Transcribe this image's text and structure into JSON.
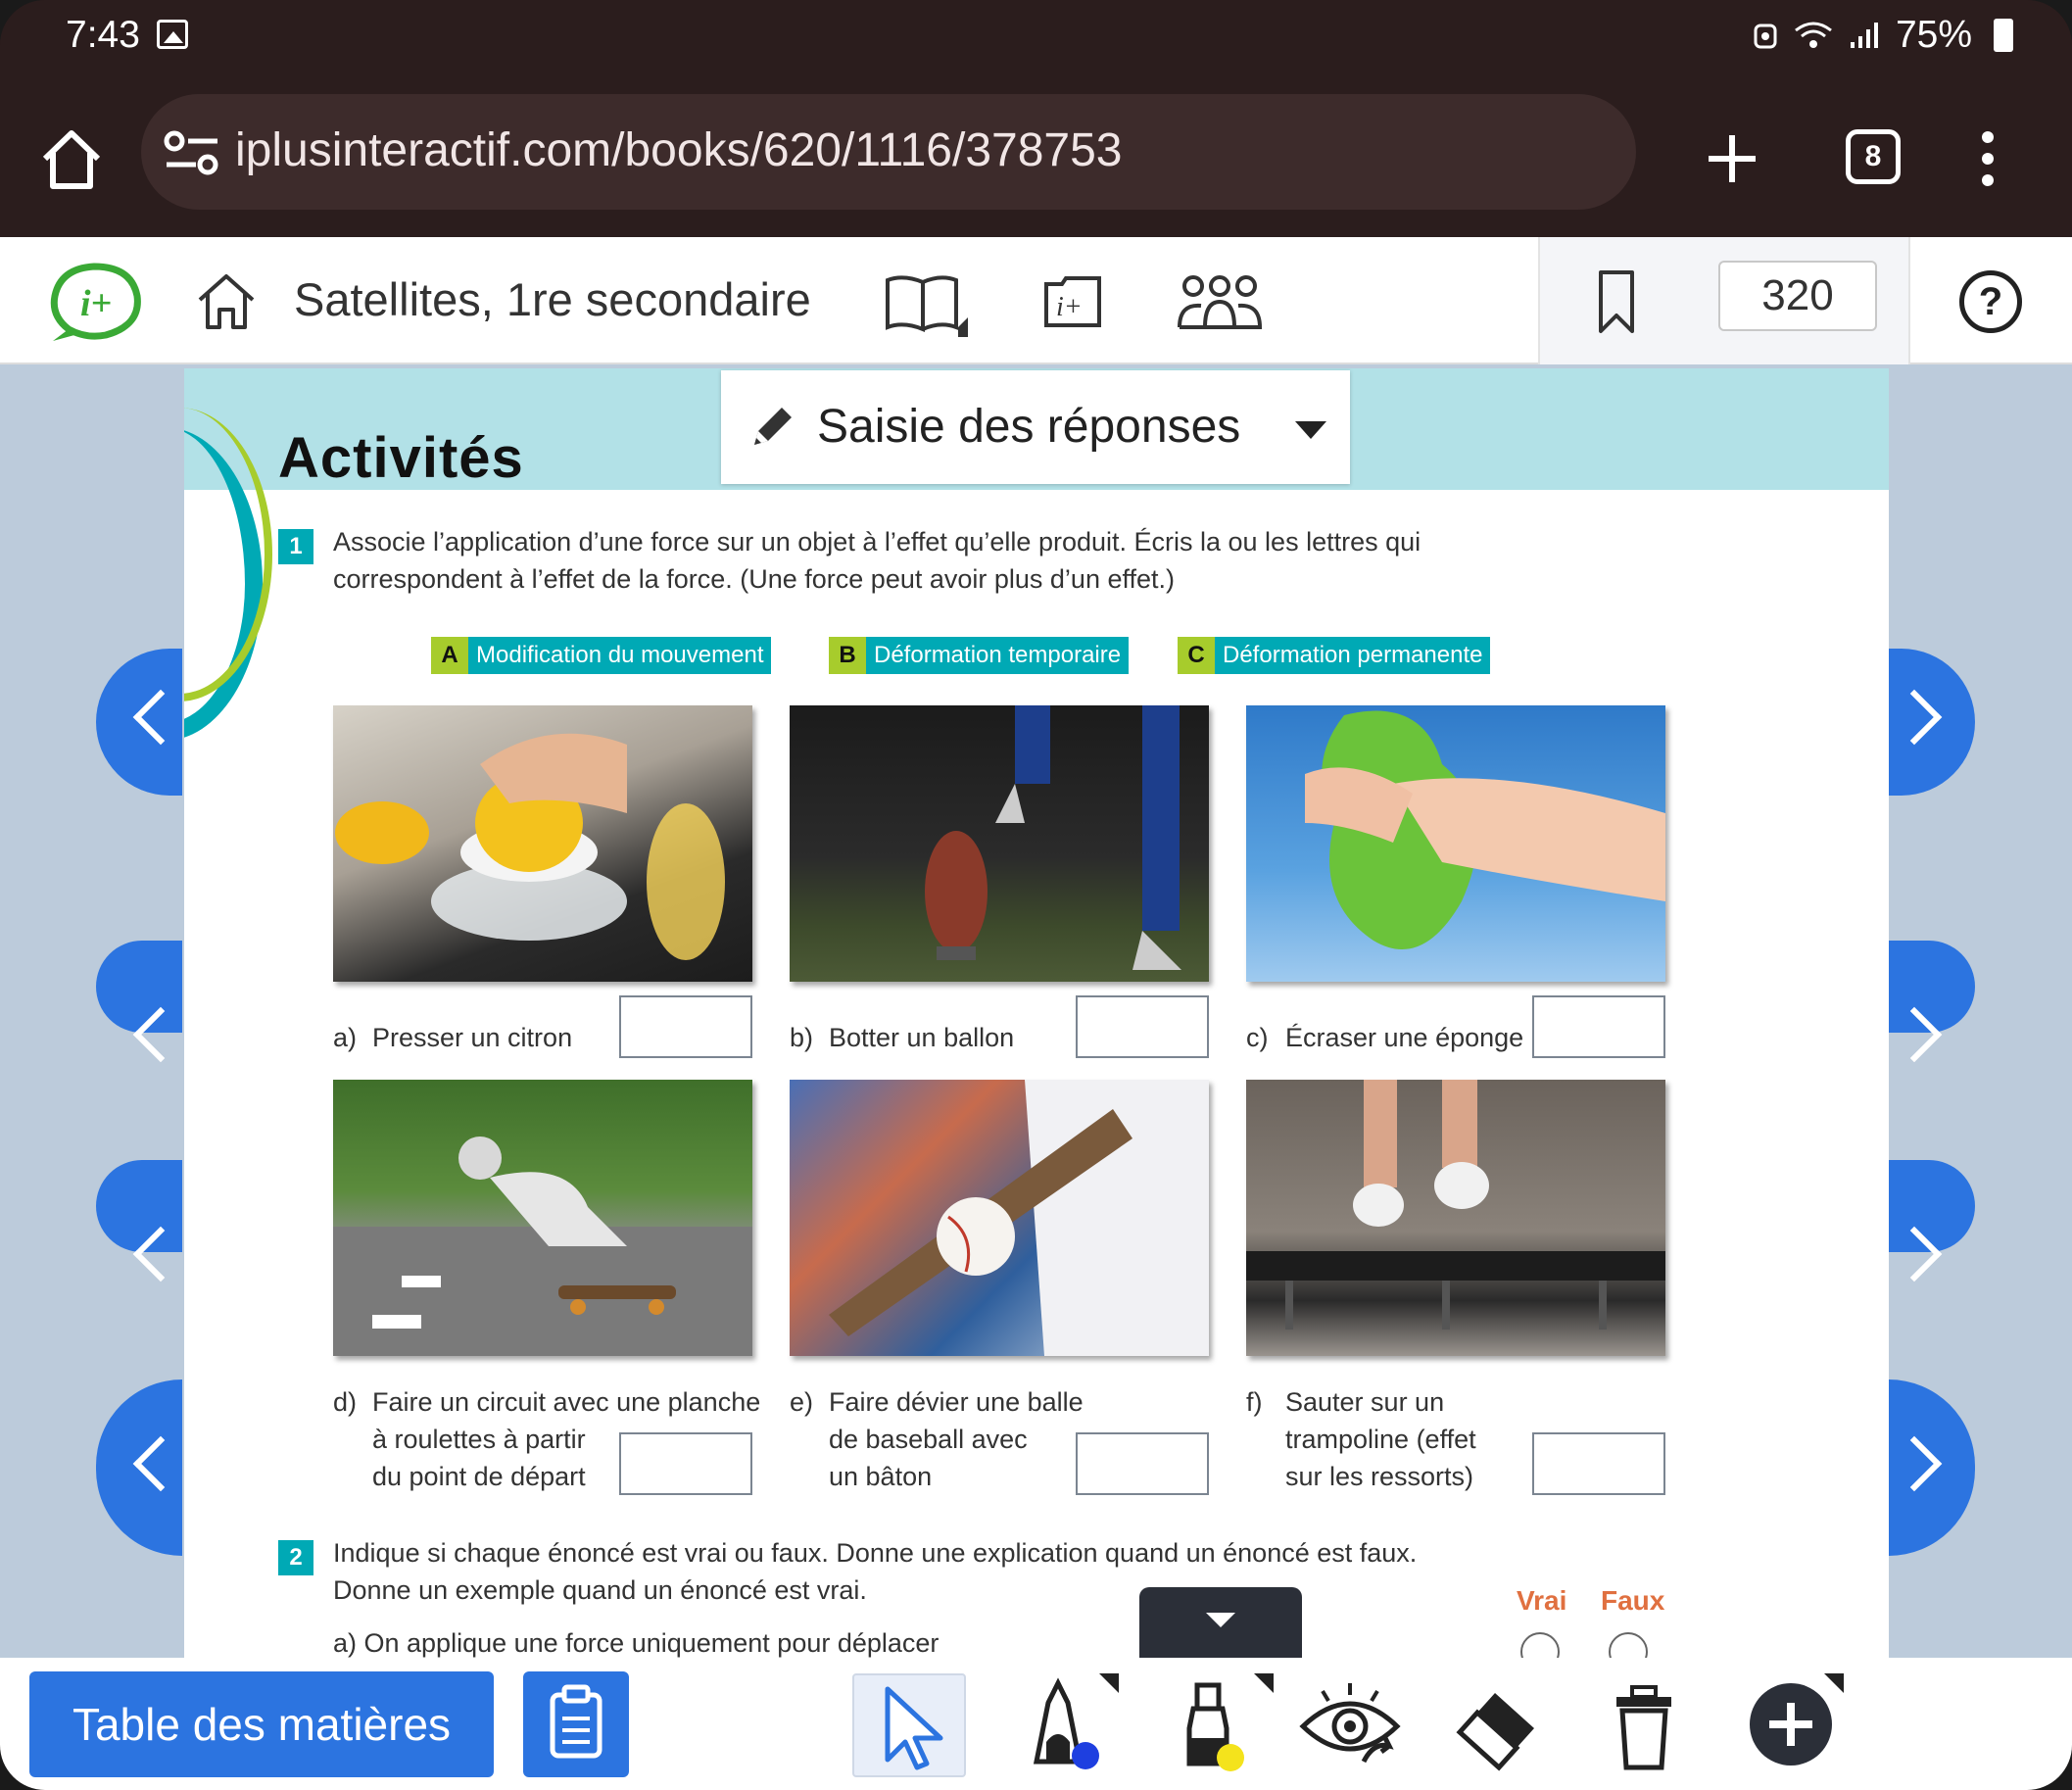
{
  "status": {
    "time": "7:43",
    "battery": "75%"
  },
  "browser": {
    "url": "iplusinteractif.com/books/620/1116/378753",
    "tab_count": "8"
  },
  "app": {
    "title": "Satellites, 1re secondaire",
    "page_number": "320"
  },
  "answer_mode": {
    "label": "Saisie des réponses"
  },
  "page": {
    "heading": "Activités",
    "q1": {
      "number": "1",
      "line1": "Associe l’application d’une force sur un objet à l’effet qu’elle produit. Écris la ou les lettres qui",
      "line2": "correspondent à l’effet de la force. (Une force peut avoir plus d’un effet.)",
      "effects": [
        {
          "letter": "A",
          "label": "Modification du mouvement"
        },
        {
          "letter": "B",
          "label": "Déformation temporaire"
        },
        {
          "letter": "C",
          "label": "Déformation permanente"
        }
      ],
      "items": [
        {
          "letter": "a)",
          "lines": [
            "Presser un citron"
          ]
        },
        {
          "letter": "b)",
          "lines": [
            "Botter un ballon"
          ]
        },
        {
          "letter": "c)",
          "lines": [
            "Écraser une éponge"
          ]
        },
        {
          "letter": "d)",
          "lines": [
            "Faire un circuit avec une planche",
            "à roulettes à partir",
            "du point de départ"
          ]
        },
        {
          "letter": "e)",
          "lines": [
            "Faire dévier une balle",
            "de baseball avec",
            "un bâton"
          ]
        },
        {
          "letter": "f)",
          "lines": [
            "Sauter sur un",
            "trampoline (effet",
            "sur les ressorts)"
          ]
        }
      ]
    },
    "q2": {
      "number": "2",
      "line1": "Indique si chaque énoncé est vrai ou faux. Donne une explication quand un énoncé est faux.",
      "line2": "Donne un exemple quand un énoncé est vrai.",
      "true_label": "Vrai",
      "false_label": "Faux",
      "partial": "a) On applique une force uniquement pour déplacer"
    }
  },
  "bottom": {
    "toc_label": "Table des matières"
  },
  "colors": {
    "accent": "#2c74e0",
    "teal": "#00a9b5",
    "lime": "#a7cc2c",
    "banner": "#b2e1e7",
    "browser_bg": "#2b1d1d"
  }
}
